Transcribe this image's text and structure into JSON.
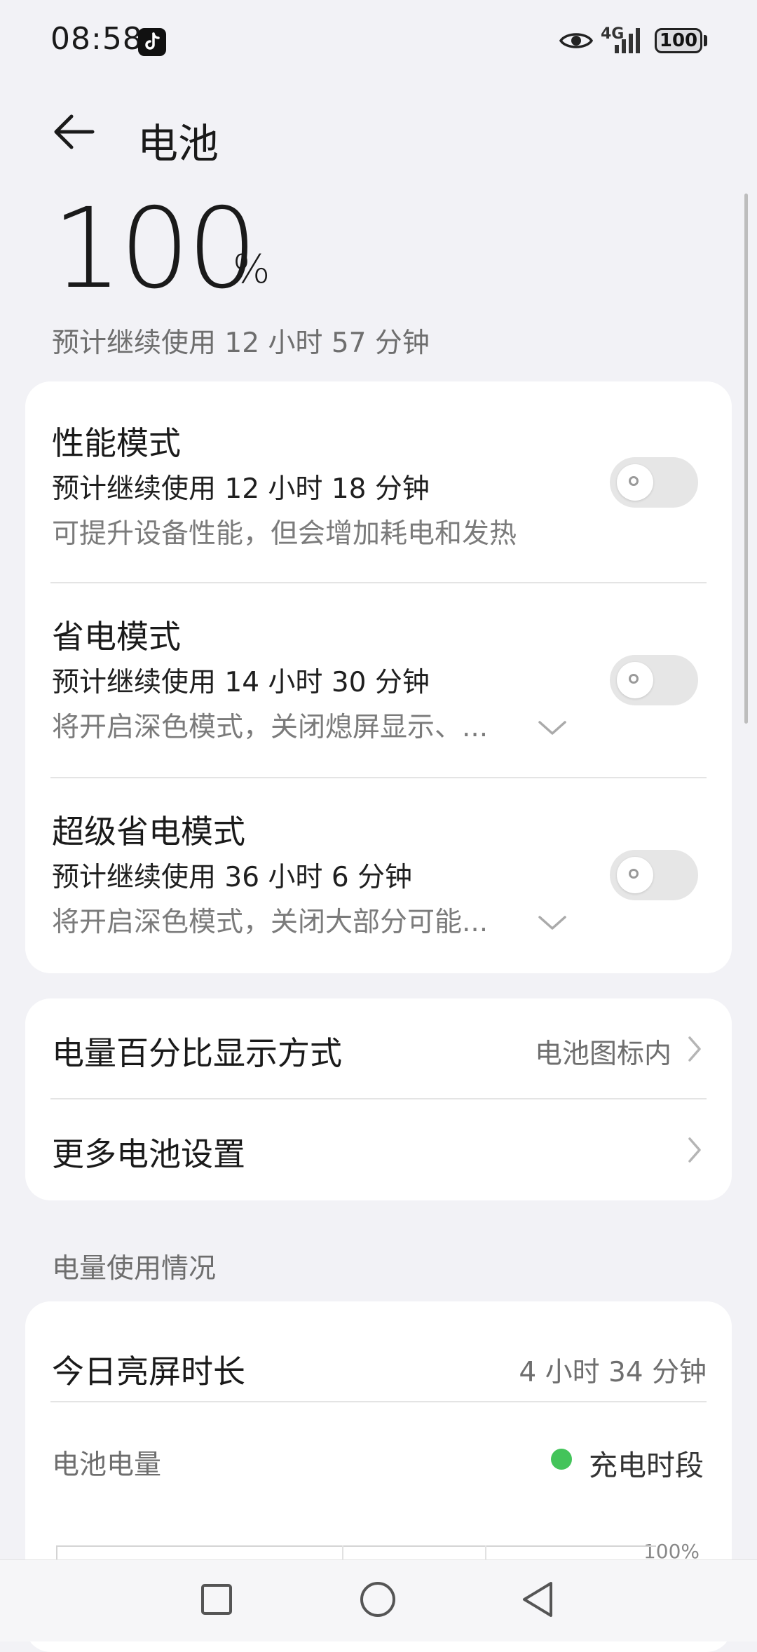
{
  "status_bar": {
    "time": "08:58",
    "network": "4G",
    "battery": "100",
    "icons": [
      "tiktok-icon",
      "eye-icon",
      "signal-icon",
      "battery-icon"
    ]
  },
  "header": {
    "title": "电池",
    "back_icon": "arrow-left-icon"
  },
  "battery": {
    "percent": "100",
    "unit": "%",
    "remaining": "预计继续使用 12 小时 57 分钟"
  },
  "modes": [
    {
      "title": "性能模式",
      "estimate": "预计继续使用 12 小时 18 分钟",
      "description": "可提升设备性能，但会增加耗电和发热",
      "enabled": false,
      "expandable": false
    },
    {
      "title": "省电模式",
      "estimate": "预计继续使用 14 小时 30 分钟",
      "description": "将开启深色模式，关闭熄屏显示、...",
      "enabled": false,
      "expandable": true
    },
    {
      "title": "超级省电模式",
      "estimate": "预计继续使用 36 小时 6 分钟",
      "description": "将开启深色模式，关闭大部分可能...",
      "enabled": false,
      "expandable": true
    }
  ],
  "settings": [
    {
      "title": "电量百分比显示方式",
      "value": "电池图标内"
    },
    {
      "title": "更多电池设置",
      "value": ""
    }
  ],
  "usage": {
    "section_label": "电量使用情况",
    "screen_time_label": "今日亮屏时长",
    "screen_time_value": "4 小时 34 分钟",
    "chart_label": "电池电量",
    "legend_label": "充电时段",
    "legend_color": "#43c45a",
    "axis_max_label": "100%"
  },
  "navbar": {
    "icons": [
      "recent-apps-icon",
      "home-icon",
      "back-icon"
    ]
  }
}
